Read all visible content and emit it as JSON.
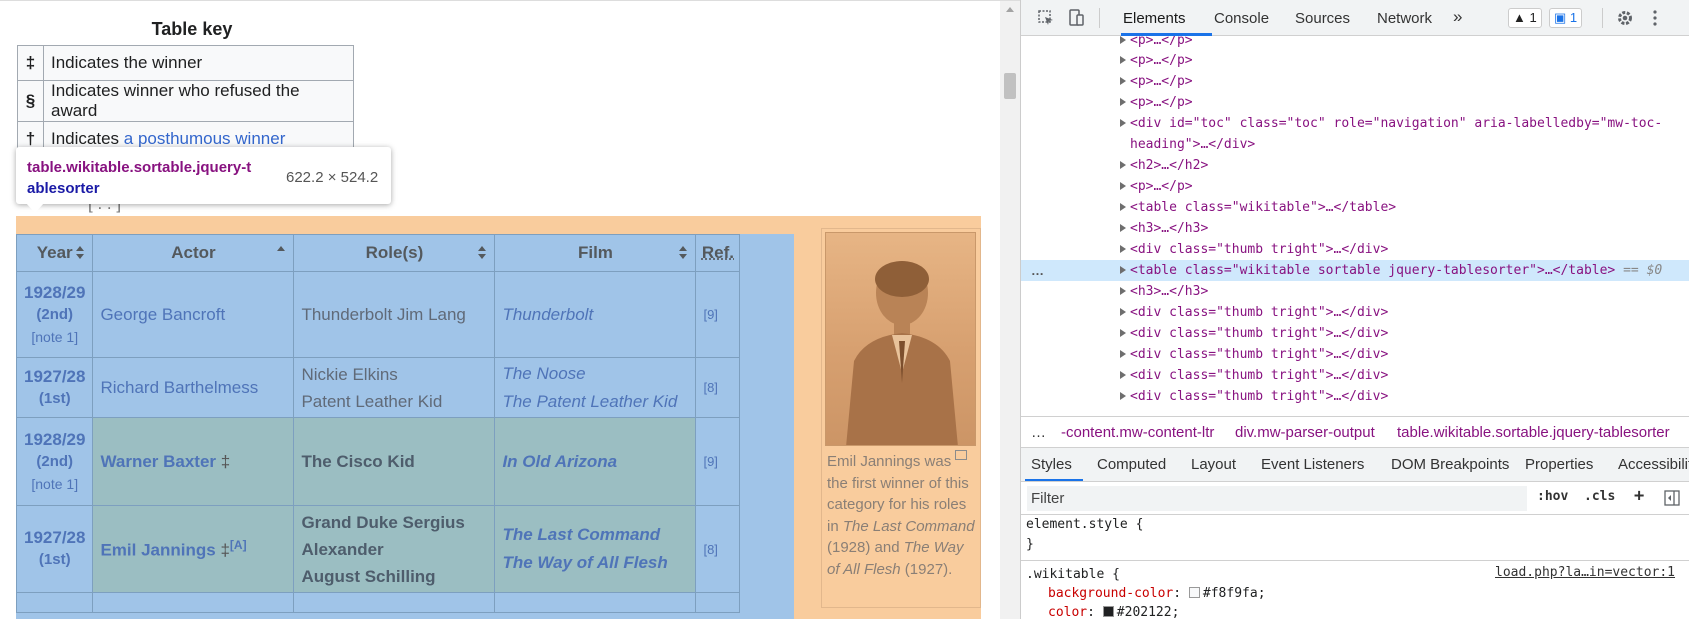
{
  "page": {
    "key_title": "Table key",
    "key_rows": [
      {
        "symbol": "‡",
        "text": "Indicates the winner"
      },
      {
        "symbol": "§",
        "text": "Indicates winner who refused the award"
      },
      {
        "symbol": "†",
        "text_before": "Indicates ",
        "link": "a posthumous winner"
      }
    ],
    "tooltip": {
      "selector_line1": "table.wikitable.sortable.jquery-t",
      "selector_line2": "ablesorter",
      "dimensions": "622.2 × 524.2"
    },
    "caption_fragment": "[ . . ]",
    "table": {
      "headers": [
        "Year",
        "Actor",
        "Role(s)",
        "Film",
        "Ref."
      ],
      "rows": [
        {
          "year": "1928/29",
          "ordinal": "(2nd)",
          "note": "[note 1]",
          "actor": "George Bancroft",
          "marker": "",
          "roles": [
            "Thunderbolt Jim Lang"
          ],
          "films": [
            "Thunderbolt"
          ],
          "ref": "[9]",
          "winner": false
        },
        {
          "year": "1927/28",
          "ordinal": "(1st)",
          "note": "",
          "actor": "Richard Barthelmess",
          "marker": "",
          "roles": [
            "Nickie Elkins",
            "Patent Leather Kid"
          ],
          "films": [
            "The Noose",
            "The Patent Leather Kid"
          ],
          "ref": "[8]",
          "winner": false
        },
        {
          "year": "1928/29",
          "ordinal": "(2nd)",
          "note": "[note 1]",
          "actor": "Warner Baxter",
          "marker": "‡",
          "roles": [
            "The Cisco Kid"
          ],
          "films": [
            "In Old Arizona"
          ],
          "ref": "[9]",
          "winner": true
        },
        {
          "year": "1927/28",
          "ordinal": "(1st)",
          "note": "",
          "actor": "Emil Jannings",
          "marker": "‡",
          "sup": "[A]",
          "roles": [
            "Grand Duke Sergius",
            "Alexander",
            "August Schilling"
          ],
          "films": [
            "The Last Command",
            "The Way of All Flesh"
          ],
          "ref": "[8]",
          "winner": true
        }
      ]
    },
    "thumb_caption": {
      "p1": "Emil Jannings was the first winner of this category for his roles in ",
      "film1": "The Last Command",
      "p2": " (1928) and ",
      "film2": "The Way of All Flesh",
      "p3": " (1927)."
    }
  },
  "devtools": {
    "tabs": [
      "Elements",
      "Console",
      "Sources",
      "Network"
    ],
    "more": "»",
    "warn_count": "1",
    "msg_count": "1",
    "dom_lines": [
      {
        "text": "<p>…</p>"
      },
      {
        "text": "<p>…</p>"
      },
      {
        "text": "<p>…</p>"
      },
      {
        "text": "<p>…</p>"
      },
      {
        "text": "<div id=\"toc\" class=\"toc\" role=\"navigation\" aria-labelledby=\"mw-toc-"
      },
      {
        "text": "heading\">…</div>"
      },
      {
        "text": "<h2>…</h2>"
      },
      {
        "text": "<p>…</p>"
      },
      {
        "text": "<table class=\"wikitable\">…</table>"
      },
      {
        "text": "<h3>…</h3>"
      },
      {
        "text": "<div class=\"thumb tright\">…</div>"
      },
      {
        "text": "<table class=\"wikitable sortable jquery-tablesorter\">…</table>",
        "suffix": "== $0"
      },
      {
        "text": "<h3>…</h3>"
      },
      {
        "text": "<div class=\"thumb tright\">…</div>"
      },
      {
        "text": "<div class=\"thumb tright\">…</div>"
      },
      {
        "text": "<div class=\"thumb tright\">…</div>"
      },
      {
        "text": "<div class=\"thumb tright\">…</div>"
      },
      {
        "text": "<div class=\"thumb tright\">…</div>"
      }
    ],
    "dots": "…",
    "breadcrumbs": [
      "…",
      "-content.mw-content-ltr",
      "div.mw-parser-output",
      "table.wikitable.sortable.jquery-tablesorter"
    ],
    "style_tabs": [
      "Styles",
      "Computed",
      "Layout",
      "Event Listeners",
      "DOM Breakpoints",
      "Properties",
      "Accessibilit"
    ],
    "filter_placeholder": "Filter",
    "hov": ":hov",
    "cls": ".cls",
    "plus": "+",
    "element_style": "element.style {",
    "close_brace": "}",
    "rule_selector": ".wikitable {",
    "rule_source": "load.php?la…in=vector:1",
    "rule_props": [
      {
        "name": "background-color",
        "value": "#f8f9fa",
        "swatch": "#f8f9fa"
      },
      {
        "name": "color",
        "value": "#202122",
        "swatch": "#202122"
      }
    ]
  }
}
